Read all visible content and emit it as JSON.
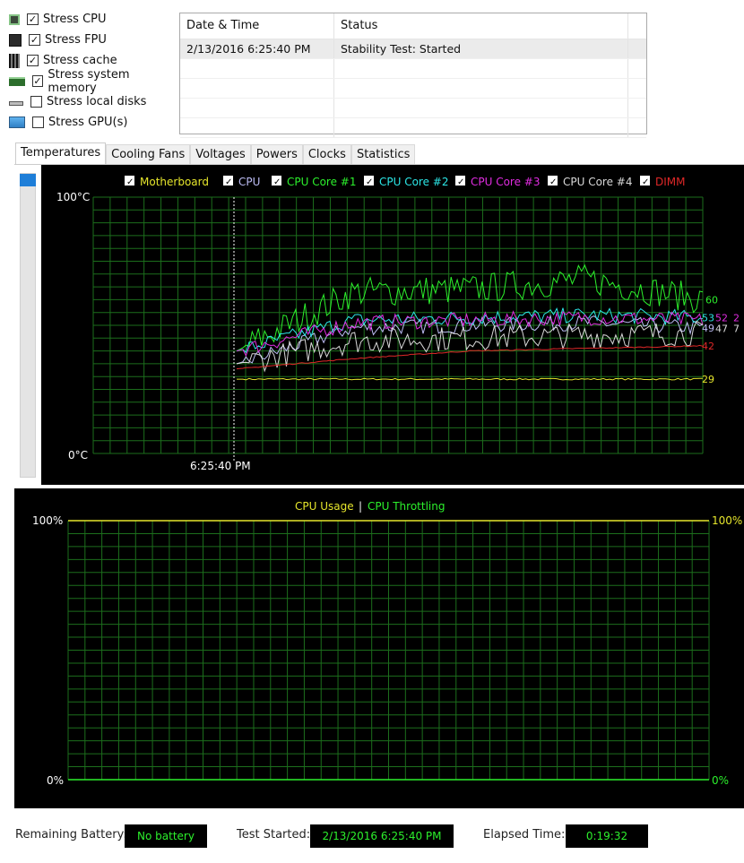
{
  "stress_options": [
    {
      "label": "Stress CPU",
      "checked": true,
      "icon": "cpu-icon"
    },
    {
      "label": "Stress FPU",
      "checked": true,
      "icon": "fpu-icon"
    },
    {
      "label": "Stress cache",
      "checked": true,
      "icon": "cache-icon"
    },
    {
      "label": "Stress system memory",
      "checked": true,
      "icon": "memory-icon"
    },
    {
      "label": "Stress local disks",
      "checked": false,
      "icon": "disk-icon"
    },
    {
      "label": "Stress GPU(s)",
      "checked": false,
      "icon": "gpu-icon"
    }
  ],
  "log": {
    "columns": [
      "Date & Time",
      "Status"
    ],
    "rows": [
      {
        "datetime": "2/13/2016 6:25:40 PM",
        "status": "Stability Test: Started"
      }
    ]
  },
  "tabs": [
    "Temperatures",
    "Cooling Fans",
    "Voltages",
    "Powers",
    "Clocks",
    "Statistics"
  ],
  "active_tab": 0,
  "temperature_chart": {
    "y_max_label": "100°C",
    "y_min_label": "0°C",
    "time_label": "6:25:40 PM",
    "legend": [
      {
        "label": "Motherboard",
        "color": "#e6e62c"
      },
      {
        "label": "CPU",
        "color": "#bdbdf5"
      },
      {
        "label": "CPU Core #1",
        "color": "#2cf02c"
      },
      {
        "label": "CPU Core #2",
        "color": "#2ce6e6"
      },
      {
        "label": "CPU Core #3",
        "color": "#e02ce0"
      },
      {
        "label": "CPU Core #4",
        "color": "#d8d8d8"
      },
      {
        "label": "DIMM",
        "color": "#e02828"
      }
    ],
    "end_labels": [
      {
        "text": "60",
        "color": "#2cf02c"
      },
      {
        "text": "53",
        "color": "#2ce6e6"
      },
      {
        "text": "52",
        "color": "#e02ce0"
      },
      {
        "text": "2",
        "color": "#e02ce0"
      },
      {
        "text": "49",
        "color": "#bdbdf5"
      },
      {
        "text": "47",
        "color": "#d8d8d8"
      },
      {
        "text": "7",
        "color": "#d8d8d8"
      },
      {
        "text": "42",
        "color": "#e02828"
      },
      {
        "text": "29",
        "color": "#e6e62c"
      }
    ]
  },
  "usage_chart": {
    "title_usage": "CPU Usage",
    "separator": "|",
    "title_throttling": "CPU Throttling",
    "left_max": "100%",
    "left_min": "0%",
    "right_max": "100%",
    "right_min": "0%",
    "usage_color": "#e6e62c",
    "throttling_color": "#2cf02c"
  },
  "status_bar": {
    "battery_label": "Remaining Battery:",
    "battery_value": "No battery",
    "started_label": "Test Started:",
    "started_value": "2/13/2016 6:25:40 PM",
    "elapsed_label": "Elapsed Time:",
    "elapsed_value": "0:19:32"
  },
  "chart_data": [
    {
      "type": "line",
      "ylabel": "",
      "ylim": [
        0,
        100
      ],
      "series": [
        {
          "name": "Motherboard",
          "values": [
            29,
            29,
            29,
            29,
            29
          ]
        },
        {
          "name": "CPU",
          "values": [
            35,
            49,
            50,
            51,
            49
          ]
        },
        {
          "name": "CPU Core #1",
          "values": [
            40,
            63,
            64,
            68,
            60
          ]
        },
        {
          "name": "CPU Core #2",
          "values": [
            40,
            52,
            53,
            54,
            53
          ]
        },
        {
          "name": "CPU Core #3",
          "values": [
            40,
            51,
            52,
            53,
            52
          ]
        },
        {
          "name": "CPU Core #4",
          "values": [
            35,
            44,
            45,
            46,
            47
          ]
        },
        {
          "name": "DIMM",
          "values": [
            33,
            37,
            40,
            41,
            42
          ]
        }
      ]
    },
    {
      "type": "line",
      "ylim": [
        0,
        100
      ],
      "series": [
        {
          "name": "CPU Usage",
          "values": [
            100,
            100,
            100
          ]
        },
        {
          "name": "CPU Throttling",
          "values": [
            0,
            0,
            0
          ]
        }
      ]
    }
  ]
}
